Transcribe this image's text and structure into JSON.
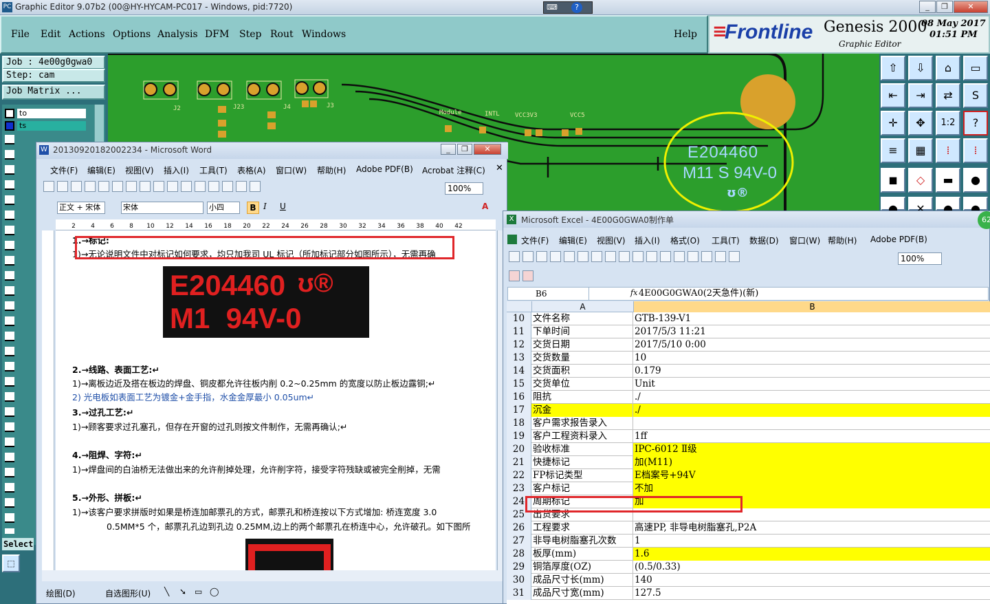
{
  "app": {
    "title": "Graphic Editor 9.07b2 (00@HY-HYCAM-PC017 - Windows, pid:7720)",
    "menu": [
      "File",
      "Edit",
      "Actions",
      "Options",
      "Analysis",
      "DFM",
      "Step",
      "Rout",
      "Windows"
    ],
    "help": "Help",
    "brand": "Frontline",
    "product": "Genesis 2000",
    "subtitle": "Graphic Editor",
    "date": "08 May 2017",
    "time": "01:51 PM"
  },
  "job_panel": {
    "job": "Job  : 4e00g0gwa0",
    "step": "Step: cam",
    "matrix": "Job Matrix ...",
    "layer_to": "to",
    "layer_ts": "ts",
    "select_label": "Select"
  },
  "canvas": {
    "ul_line1": "E204460",
    "ul_line2": "M11 S 94V-0",
    "labels": [
      "J2",
      "J23",
      "J4",
      "J3",
      "Module",
      "INTL",
      "VCC3V3",
      "VCC5"
    ]
  },
  "word": {
    "title": "20130920182002234 - Microsoft Word",
    "menu": [
      "文件(F)",
      "编辑(E)",
      "视图(V)",
      "插入(I)",
      "工具(T)",
      "表格(A)",
      "窗口(W)",
      "帮助(H)",
      "Adobe PDF(B)",
      "Acrobat 注释(C)"
    ],
    "zoom": "100%",
    "style": "正文 + 宋体",
    "font": "宋体",
    "size": "小四",
    "ruler": [
      "2",
      "4",
      "6",
      "8",
      "10",
      "12",
      "14",
      "16",
      "18",
      "20",
      "22",
      "24",
      "26",
      "28",
      "30",
      "32",
      "34",
      "36",
      "38",
      "40",
      "42"
    ],
    "lines": {
      "h1": "1.→标记:",
      "l1": "1)→无论说明文件中对标记如何要求，均只加我司 UL 标记（所加标记部分如图所示），无需再确",
      "ul_a": "E204460",
      "ul_b": "M1  94V-0",
      "h2": "2.→线路、表面工艺:↵",
      "l2a": "1)→离板边近及搭在板边的焊盘、铜皮都允许往板内削 0.2~0.25mm 的宽度以防止板边露铜;↵",
      "l2b": "2) 光电板如表面工艺为镀金+金手指，水金金厚最小 0.05um↵",
      "h3": "3.→过孔工艺:↵",
      "l3": "1)→顾客要求过孔塞孔，但存在开窗的过孔则按文件制作，无需再确认;↵",
      "h4": "4.→阻焊、字符:↵",
      "l4": "1)→焊盘间的白油桥无法做出来的允许削掉处理，允许削字符，接受字符残缺或被完全削掉，无需",
      "h5": "5.→外形、拼板:↵",
      "l5a": "1)→该客户要求拼版时如果是桥连加邮票孔的方式，邮票孔和桥连按以下方式增加: 桥连宽度 3.0",
      "l5b": "0.5MM*5 个，邮票孔孔边到孔边 0.25MM,边上的两个邮票孔在桥连中心，允许破孔。如下图所"
    },
    "draw_label": "绘图(D)",
    "autoshape": "自选图形(U)"
  },
  "excel": {
    "title": "Microsoft Excel - 4E00G0GWA0制作单",
    "menu": [
      "文件(F)",
      "编辑(E)",
      "视图(V)",
      "插入(I)",
      "格式(O)",
      "工具(T)",
      "数据(D)",
      "窗口(W)",
      "帮助(H)",
      "Adobe PDF(B)"
    ],
    "zoom": "100%",
    "namebox": "B6",
    "fx": "fx",
    "formula": "4E00G0GWA0(2天急件)(新)",
    "col_a": "A",
    "col_b": "B",
    "rows": [
      {
        "n": "10",
        "a": "文件名称",
        "b": "GTB-139-V1",
        "hl": false
      },
      {
        "n": "11",
        "a": "下单时间",
        "b": "2017/5/3 11:21",
        "hl": false
      },
      {
        "n": "12",
        "a": "交货日期",
        "b": "2017/5/10 0:00",
        "hl": false
      },
      {
        "n": "13",
        "a": "交货数量",
        "b": "10",
        "hl": false
      },
      {
        "n": "14",
        "a": "交货面积",
        "b": "0.179",
        "hl": false
      },
      {
        "n": "15",
        "a": "交货单位",
        "b": "Unit",
        "hl": false
      },
      {
        "n": "16",
        "a": "阻抗",
        "b": "./",
        "hl": false
      },
      {
        "n": "17",
        "a": "沉金",
        "b": "./",
        "hl": true
      },
      {
        "n": "18",
        "a": "客户需求报告录入",
        "b": "",
        "hl": false
      },
      {
        "n": "19",
        "a": "客户工程资料录入",
        "b": "1ff",
        "hl": false
      },
      {
        "n": "20",
        "a": "验收标准",
        "b": "IPC-6012 Ⅱ级",
        "hl": true
      },
      {
        "n": "21",
        "a": "快捷标记",
        "b": "加(M11)",
        "hl": true
      },
      {
        "n": "22",
        "a": "FP标记类型",
        "b": "E档案号+94V",
        "hl": true
      },
      {
        "n": "23",
        "a": "客户标记",
        "b": "不加",
        "hl": true
      },
      {
        "n": "24",
        "a": "周期标记",
        "b": "加",
        "hl": true
      },
      {
        "n": "25",
        "a": "出货要求",
        "b": "",
        "hl": false
      },
      {
        "n": "26",
        "a": "工程要求",
        "b": "高速PP, 非导电树脂塞孔,P2A",
        "hl": false
      },
      {
        "n": "27",
        "a": "非导电树脂塞孔次数",
        "b": "1",
        "hl": false
      },
      {
        "n": "28",
        "a": "板厚(mm)",
        "b": "1.6",
        "hl": true
      },
      {
        "n": "29",
        "a": "铜箔厚度(OZ)",
        "b": "(0.5/0.33)",
        "hl": false
      },
      {
        "n": "30",
        "a": "成品尺寸长(mm)",
        "b": "140",
        "hl": false
      },
      {
        "n": "31",
        "a": "成品尺寸宽(mm)",
        "b": "127.5",
        "hl": false
      }
    ],
    "side_badge": "62"
  }
}
